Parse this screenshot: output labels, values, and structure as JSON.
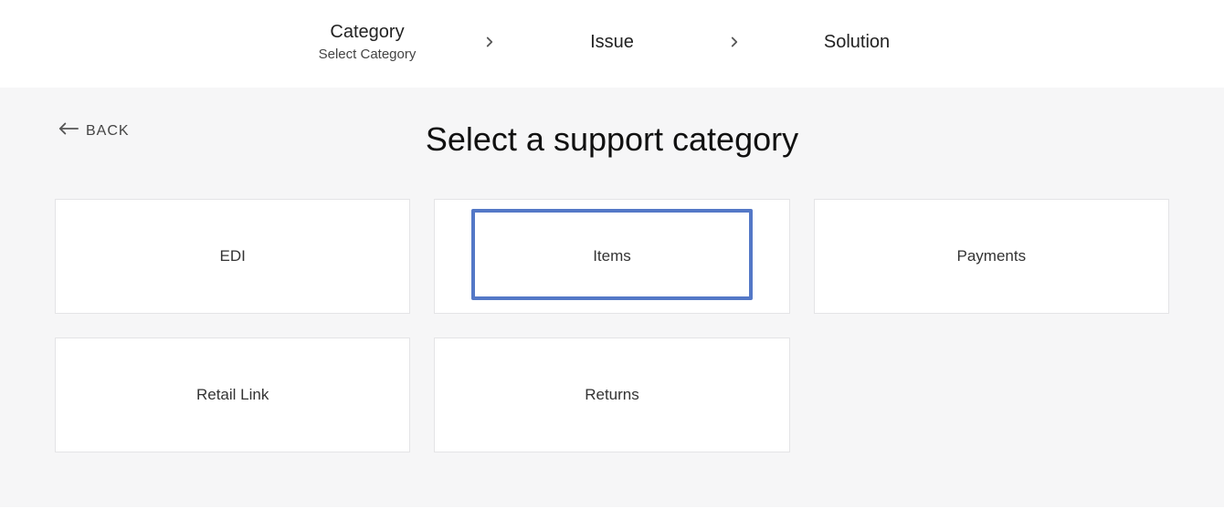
{
  "stepper": {
    "steps": [
      {
        "title": "Category",
        "sub": "Select Category",
        "active": true
      },
      {
        "title": "Issue",
        "sub": "",
        "active": false
      },
      {
        "title": "Solution",
        "sub": "",
        "active": false
      }
    ]
  },
  "back_label": "BACK",
  "panel_title": "Select a support category",
  "categories": [
    {
      "label": "EDI"
    },
    {
      "label": "Items",
      "highlighted": true
    },
    {
      "label": "Payments"
    },
    {
      "label": "Retail Link"
    },
    {
      "label": "Returns"
    }
  ],
  "colors": {
    "highlight": "#5478c7",
    "panel_bg": "#f6f6f7",
    "card_border": "#e4e4e6"
  }
}
